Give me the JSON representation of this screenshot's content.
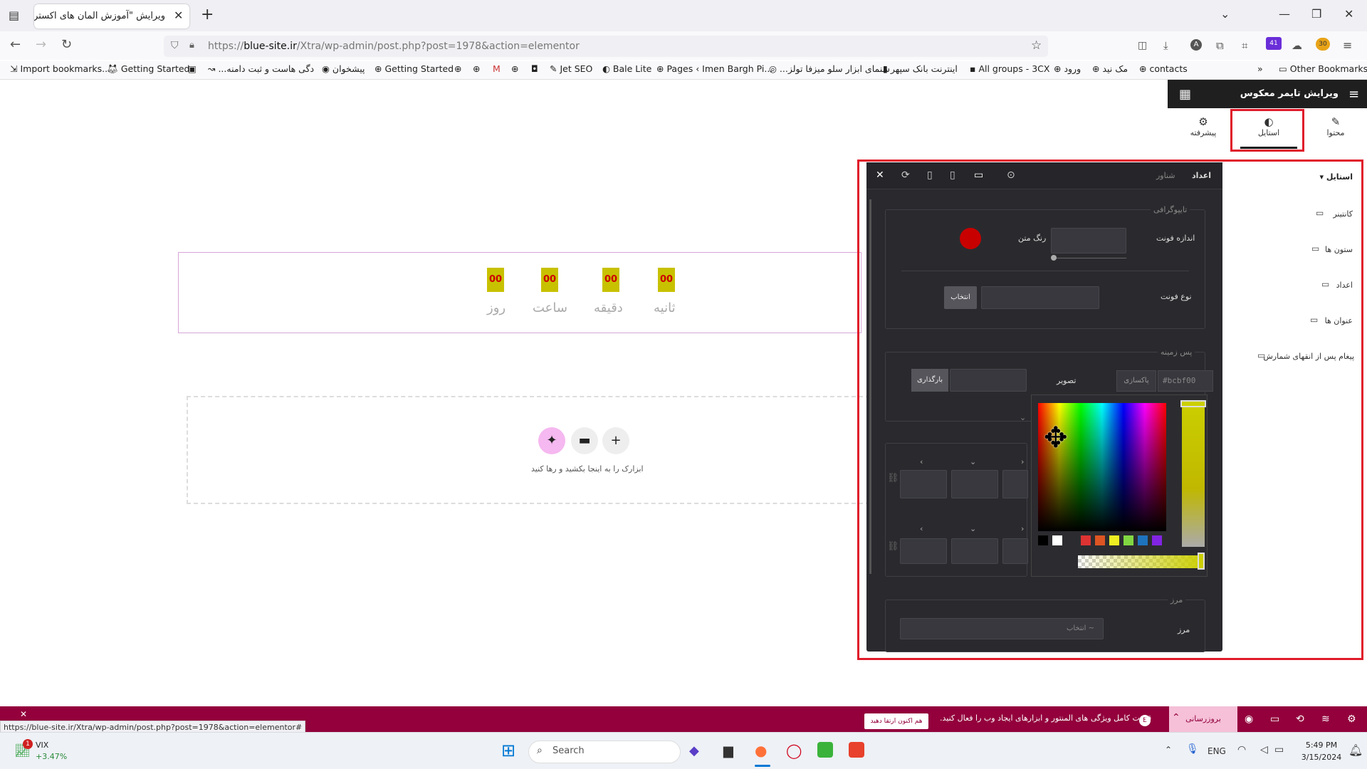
{
  "browser": {
    "tab_title": "ویرایش \"آموزش المان های اکسترا – ما",
    "url_prefix": "https://",
    "url_host": "blue-site.ir",
    "url_path": "/Xtra/wp-admin/post.php?post=1978&action=elementor",
    "bookmarks": [
      "Import bookmarks...",
      "Getting Started",
      "...دگی هاست و ثبت دامنه",
      "پیشخوان",
      "Getting Started",
      "Jet SEO",
      "Bale Lite",
      "Pages ‹ Imen Bargh Pi...",
      "...سنمای ابزار سلو میزفا تولز",
      "اینترنت بانک سپهر",
      "All groups - 3CX",
      "ورود",
      "مک نید",
      "contacts"
    ],
    "other_bookmarks": "Other Bookmarks",
    "ext_badge": "41",
    "ext_badge2": "30"
  },
  "canvas": {
    "countdown": [
      {
        "digits": "00",
        "unit": "ثانیه"
      },
      {
        "digits": "00",
        "unit": "دقیقه"
      },
      {
        "digits": "00",
        "unit": "ساعت"
      },
      {
        "digits": "00",
        "unit": "روز"
      }
    ],
    "drop_hint": "ابزارک را به اینجا بکشید و رها کنید"
  },
  "editor": {
    "title": "ویرایش تایمر معکوس",
    "tabs": {
      "content": "محتوا",
      "style": "استایل",
      "advanced": "پیشرفته"
    },
    "section_style": "استایل",
    "items": [
      "کانتینر",
      "ستون ها",
      "اعداد",
      "عنوان ها",
      "پیغام پس از انقهای شمارش"
    ]
  },
  "float_panel": {
    "tab_numbers": "اعداد",
    "tab_float": "شناور",
    "typography_legend": "تایپوگرافی",
    "font_size_label": "اندازه فونت",
    "text_color_label": "رنگ متن",
    "font_family_label": "نوع فونت",
    "choose_label": "انتخاب",
    "background_legend": "پس زمینه",
    "hex_value": "#bcbf00",
    "clear_label": "پاکسازی",
    "image_label": "تصویر",
    "upload_label": "بارگذاری",
    "border_legend": "مرز",
    "border_label": "مرز",
    "border_select": "انتخاب ~",
    "text_color": "#c80000"
  },
  "picker": {
    "swatches": [
      "#000000",
      "#ffffff",
      "#2c2c30",
      "#dd3333",
      "#dd5522",
      "#eeee22",
      "#81d742",
      "#1e73be",
      "#8224e3"
    ],
    "selected_color": "#cbcf00"
  },
  "bottom": {
    "update_label": "بروزرسانی",
    "promo_text": "قدرت کامل ویژگی های المنتور و ابزارهای ایجاد وب را فعال کنید.",
    "try_label": "هم اکنون ارتقا دهید",
    "status_url": "https://blue-site.ir/Xtra/wp-admin/post.php?post=1978&action=elementor#"
  },
  "taskbar": {
    "ticker": "VIX",
    "ticker_change": "+3.47%",
    "ticker_badge": "1",
    "search_placeholder": "Search",
    "lang": "ENG",
    "time": "5:49 PM",
    "date": "3/15/2024"
  }
}
